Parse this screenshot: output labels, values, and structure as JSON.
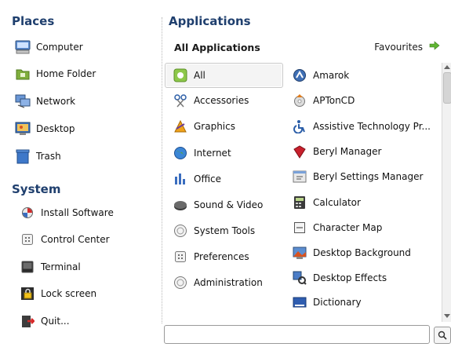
{
  "places": {
    "title": "Places",
    "items": [
      {
        "label": "Computer",
        "icon": "computer-icon"
      },
      {
        "label": "Home Folder",
        "icon": "home-folder-icon"
      },
      {
        "label": "Network",
        "icon": "network-icon"
      },
      {
        "label": "Desktop",
        "icon": "desktop-icon"
      },
      {
        "label": "Trash",
        "icon": "trash-icon"
      }
    ]
  },
  "system": {
    "title": "System",
    "items": [
      {
        "label": "Install Software",
        "icon": "install-software-icon"
      },
      {
        "label": "Control Center",
        "icon": "control-center-icon"
      },
      {
        "label": "Terminal",
        "icon": "terminal-icon"
      },
      {
        "label": "Lock screen",
        "icon": "lock-icon"
      },
      {
        "label": "Quit...",
        "icon": "quit-icon"
      }
    ]
  },
  "applications": {
    "title": "Applications",
    "header": "All Applications",
    "favourites_label": "Favourites",
    "categories": [
      {
        "label": "All",
        "icon": "all-icon",
        "selected": true
      },
      {
        "label": "Accessories",
        "icon": "accessories-icon"
      },
      {
        "label": "Graphics",
        "icon": "graphics-icon"
      },
      {
        "label": "Internet",
        "icon": "internet-icon"
      },
      {
        "label": "Office",
        "icon": "office-icon"
      },
      {
        "label": "Sound & Video",
        "icon": "sound-video-icon"
      },
      {
        "label": "System Tools",
        "icon": "system-tools-icon"
      },
      {
        "label": "Preferences",
        "icon": "preferences-icon"
      },
      {
        "label": "Administration",
        "icon": "administration-icon"
      }
    ],
    "apps": [
      {
        "label": "Amarok",
        "icon": "amarok-icon"
      },
      {
        "label": "APTonCD",
        "icon": "aptoncd-icon"
      },
      {
        "label": "Assistive Technology Pr...",
        "icon": "accessibility-icon"
      },
      {
        "label": "Beryl Manager",
        "icon": "beryl-icon"
      },
      {
        "label": "Beryl Settings Manager",
        "icon": "beryl-settings-icon"
      },
      {
        "label": "Calculator",
        "icon": "calculator-icon"
      },
      {
        "label": "Character Map",
        "icon": "character-map-icon"
      },
      {
        "label": "Desktop Background",
        "icon": "desktop-background-icon"
      },
      {
        "label": "Desktop Effects",
        "icon": "desktop-effects-icon"
      },
      {
        "label": "Dictionary",
        "icon": "dictionary-icon"
      }
    ]
  },
  "search": {
    "value": "",
    "icon": "search-icon"
  }
}
